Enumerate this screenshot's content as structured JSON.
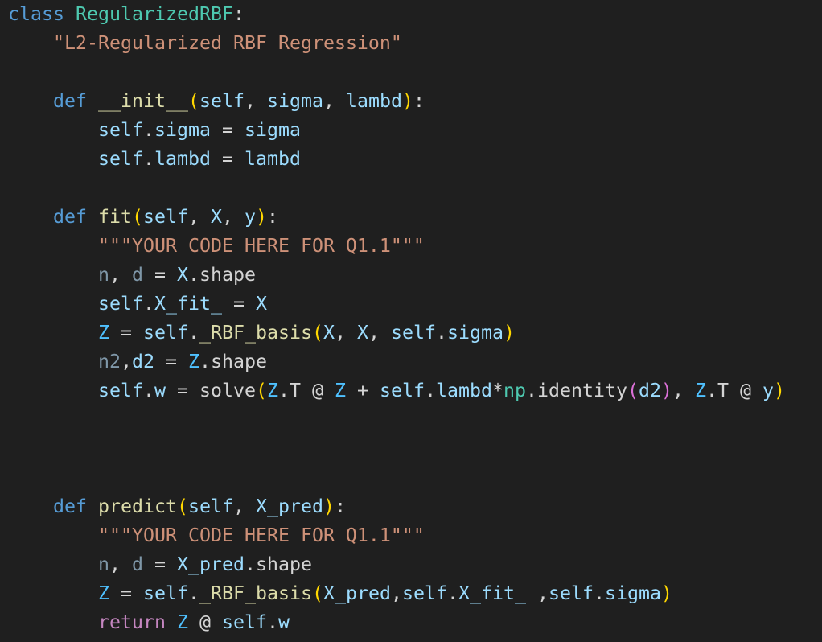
{
  "editor": {
    "language": "python",
    "lines": [
      [
        [
          "class ",
          "kw"
        ],
        [
          "RegularizedRBF",
          "cls"
        ],
        [
          ":",
          "def"
        ]
      ],
      [
        [
          "    ",
          "def"
        ],
        [
          "\"L2-Regularized RBF Regression\"",
          "str"
        ]
      ],
      [],
      [
        [
          "    ",
          "def"
        ],
        [
          "def ",
          "kw"
        ],
        [
          "__init__",
          "fn"
        ],
        [
          "(",
          "p1"
        ],
        [
          "self",
          "var"
        ],
        [
          ", ",
          "def"
        ],
        [
          "sigma",
          "var"
        ],
        [
          ", ",
          "def"
        ],
        [
          "lambd",
          "var"
        ],
        [
          ")",
          "p1"
        ],
        [
          ":",
          "def"
        ]
      ],
      [
        [
          "        ",
          "def"
        ],
        [
          "self",
          "var"
        ],
        [
          ".",
          "def"
        ],
        [
          "sigma",
          "var"
        ],
        [
          " = ",
          "def"
        ],
        [
          "sigma",
          "var"
        ]
      ],
      [
        [
          "        ",
          "def"
        ],
        [
          "self",
          "var"
        ],
        [
          ".",
          "def"
        ],
        [
          "lambd",
          "var"
        ],
        [
          " = ",
          "def"
        ],
        [
          "lambd",
          "var"
        ]
      ],
      [],
      [
        [
          "    ",
          "def"
        ],
        [
          "def ",
          "kw"
        ],
        [
          "fit",
          "fn"
        ],
        [
          "(",
          "p1"
        ],
        [
          "self",
          "var"
        ],
        [
          ", ",
          "def"
        ],
        [
          "X",
          "var"
        ],
        [
          ", ",
          "def"
        ],
        [
          "y",
          "var"
        ],
        [
          ")",
          "p1"
        ],
        [
          ":",
          "def"
        ]
      ],
      [
        [
          "        ",
          "def"
        ],
        [
          "\"\"\"YOUR CODE HERE FOR Q1.1\"\"\"",
          "str"
        ]
      ],
      [
        [
          "        ",
          "def"
        ],
        [
          "n",
          "dim"
        ],
        [
          ", ",
          "def"
        ],
        [
          "d",
          "dim"
        ],
        [
          " = ",
          "def"
        ],
        [
          "X",
          "var"
        ],
        [
          ".shape",
          "def"
        ]
      ],
      [
        [
          "        ",
          "def"
        ],
        [
          "self",
          "var"
        ],
        [
          ".",
          "def"
        ],
        [
          "X_fit_",
          "var"
        ],
        [
          " = ",
          "def"
        ],
        [
          "X",
          "var"
        ]
      ],
      [
        [
          "        ",
          "def"
        ],
        [
          "Z",
          "const"
        ],
        [
          " = ",
          "def"
        ],
        [
          "self",
          "var"
        ],
        [
          ".",
          "def"
        ],
        [
          "_RBF_basis",
          "fn"
        ],
        [
          "(",
          "p1"
        ],
        [
          "X",
          "var"
        ],
        [
          ", ",
          "def"
        ],
        [
          "X",
          "var"
        ],
        [
          ", ",
          "def"
        ],
        [
          "self",
          "var"
        ],
        [
          ".",
          "def"
        ],
        [
          "sigma",
          "var"
        ],
        [
          ")",
          "p1"
        ]
      ],
      [
        [
          "        ",
          "def"
        ],
        [
          "n2",
          "dim"
        ],
        [
          ",",
          "def"
        ],
        [
          "d2",
          "var"
        ],
        [
          " = ",
          "def"
        ],
        [
          "Z",
          "const"
        ],
        [
          ".shape",
          "def"
        ]
      ],
      [
        [
          "        ",
          "def"
        ],
        [
          "self",
          "var"
        ],
        [
          ".",
          "def"
        ],
        [
          "w",
          "var"
        ],
        [
          " = ",
          "def"
        ],
        [
          "solve",
          "def"
        ],
        [
          "(",
          "p1"
        ],
        [
          "Z",
          "const"
        ],
        [
          ".T @ ",
          "def"
        ],
        [
          "Z",
          "const"
        ],
        [
          " + ",
          "def"
        ],
        [
          "self",
          "var"
        ],
        [
          ".",
          "def"
        ],
        [
          "lambd",
          "var"
        ],
        [
          "*",
          "def"
        ],
        [
          "np",
          "ns"
        ],
        [
          ".identity",
          "def"
        ],
        [
          "(",
          "p2"
        ],
        [
          "d2",
          "var"
        ],
        [
          ")",
          "p2"
        ],
        [
          ", ",
          "def"
        ],
        [
          "Z",
          "const"
        ],
        [
          ".T @ ",
          "def"
        ],
        [
          "y",
          "var"
        ],
        [
          ")",
          "p1"
        ]
      ],
      [],
      [],
      [],
      [
        [
          "    ",
          "def"
        ],
        [
          "def ",
          "kw"
        ],
        [
          "predict",
          "fn"
        ],
        [
          "(",
          "p1"
        ],
        [
          "self",
          "var"
        ],
        [
          ", ",
          "def"
        ],
        [
          "X_pred",
          "var"
        ],
        [
          ")",
          "p1"
        ],
        [
          ":",
          "def"
        ]
      ],
      [
        [
          "        ",
          "def"
        ],
        [
          "\"\"\"YOUR CODE HERE FOR Q1.1\"\"\"",
          "str"
        ]
      ],
      [
        [
          "        ",
          "def"
        ],
        [
          "n",
          "dim"
        ],
        [
          ", ",
          "def"
        ],
        [
          "d",
          "dim"
        ],
        [
          " = ",
          "def"
        ],
        [
          "X_pred",
          "var"
        ],
        [
          ".shape",
          "def"
        ]
      ],
      [
        [
          "        ",
          "def"
        ],
        [
          "Z",
          "const"
        ],
        [
          " = ",
          "def"
        ],
        [
          "self",
          "var"
        ],
        [
          ".",
          "def"
        ],
        [
          "_RBF_basis",
          "fn"
        ],
        [
          "(",
          "p1"
        ],
        [
          "X_pred",
          "var"
        ],
        [
          ",",
          "def"
        ],
        [
          "self",
          "var"
        ],
        [
          ".",
          "def"
        ],
        [
          "X_fit_",
          "var"
        ],
        [
          " ,",
          "def"
        ],
        [
          "self",
          "var"
        ],
        [
          ".",
          "def"
        ],
        [
          "sigma",
          "var"
        ],
        [
          ")",
          "p1"
        ]
      ],
      [
        [
          "        ",
          "def"
        ],
        [
          "return ",
          "ctl"
        ],
        [
          "Z",
          "const"
        ],
        [
          " @ ",
          "def"
        ],
        [
          "self",
          "var"
        ],
        [
          ".",
          "def"
        ],
        [
          "w",
          "var"
        ]
      ]
    ]
  }
}
